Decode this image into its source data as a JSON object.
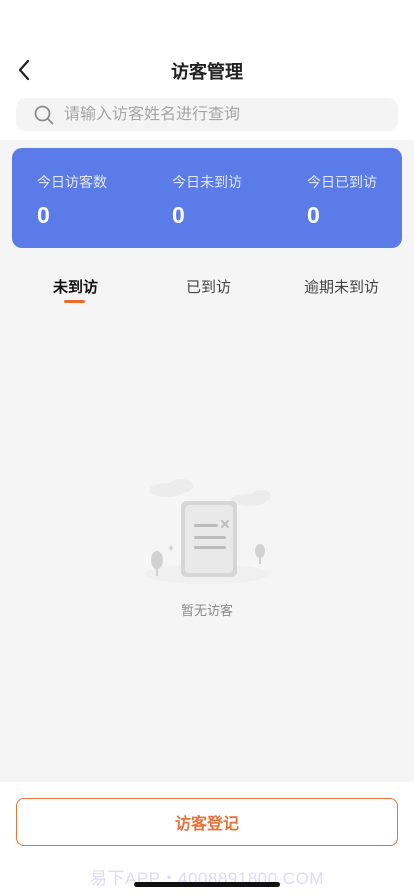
{
  "header": {
    "title": "访客管理",
    "back_icon": "chevron-left-icon"
  },
  "search": {
    "placeholder": "请输入访客姓名进行查询",
    "icon": "search-icon"
  },
  "stats": [
    {
      "label": "今日访客数",
      "value": "0"
    },
    {
      "label": "今日未到访",
      "value": "0"
    },
    {
      "label": "今日已到访",
      "value": "0"
    }
  ],
  "tabs": [
    {
      "label": "未到访",
      "active": true
    },
    {
      "label": "已到访",
      "active": false
    },
    {
      "label": "逾期未到访",
      "active": false
    }
  ],
  "empty_state": {
    "text": "暂无访客",
    "icon": "empty-document-icon"
  },
  "footer": {
    "register_label": "访客登记",
    "watermark": "易下APP・4008891800.COM"
  },
  "colors": {
    "stats_bg": "#5b7be9",
    "accent": "#e8723a",
    "tab_indicator": "#f06a2a",
    "page_bg": "#f5f5f5"
  }
}
